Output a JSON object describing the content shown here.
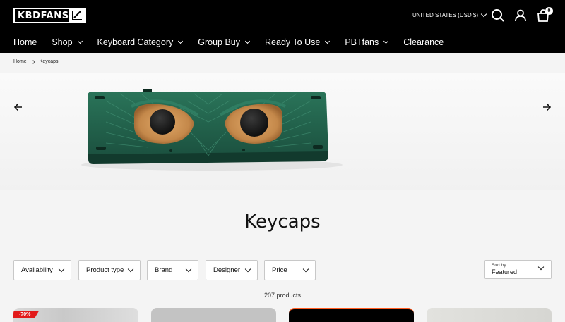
{
  "header": {
    "logo_text": "KBDFANS",
    "currency": "UNITED STATES (USD $)",
    "cart_count": "0",
    "icons": [
      "search-icon",
      "account-icon",
      "cart-icon"
    ]
  },
  "nav": {
    "items": [
      {
        "label": "Home",
        "dropdown": false
      },
      {
        "label": "Shop",
        "dropdown": true
      },
      {
        "label": "Keyboard Category",
        "dropdown": true
      },
      {
        "label": "Group Buy",
        "dropdown": true
      },
      {
        "label": "Ready To Use",
        "dropdown": true
      },
      {
        "label": "PBTfans",
        "dropdown": true
      },
      {
        "label": "Clearance",
        "dropdown": false
      }
    ]
  },
  "breadcrumb": {
    "home": "Home",
    "current": "Keycaps"
  },
  "banner": {
    "icons": [
      "arrow-left-icon",
      "arrow-right-icon"
    ]
  },
  "page": {
    "title": "Keycaps"
  },
  "filters": {
    "availability": "Availability",
    "product_type": "Product type",
    "brand": "Brand",
    "designer": "Designer",
    "price": "Price"
  },
  "sort": {
    "label": "Sort by",
    "value": "Featured"
  },
  "products": {
    "count_text": "207 products",
    "first_badge": "-70%"
  },
  "colors": {
    "header_bg": "#000000",
    "page_bg": "#f4f4f4",
    "badge": "#e21a1a",
    "keyboard_green": "#1f5a46",
    "eye_copper": "#c68a4a"
  }
}
